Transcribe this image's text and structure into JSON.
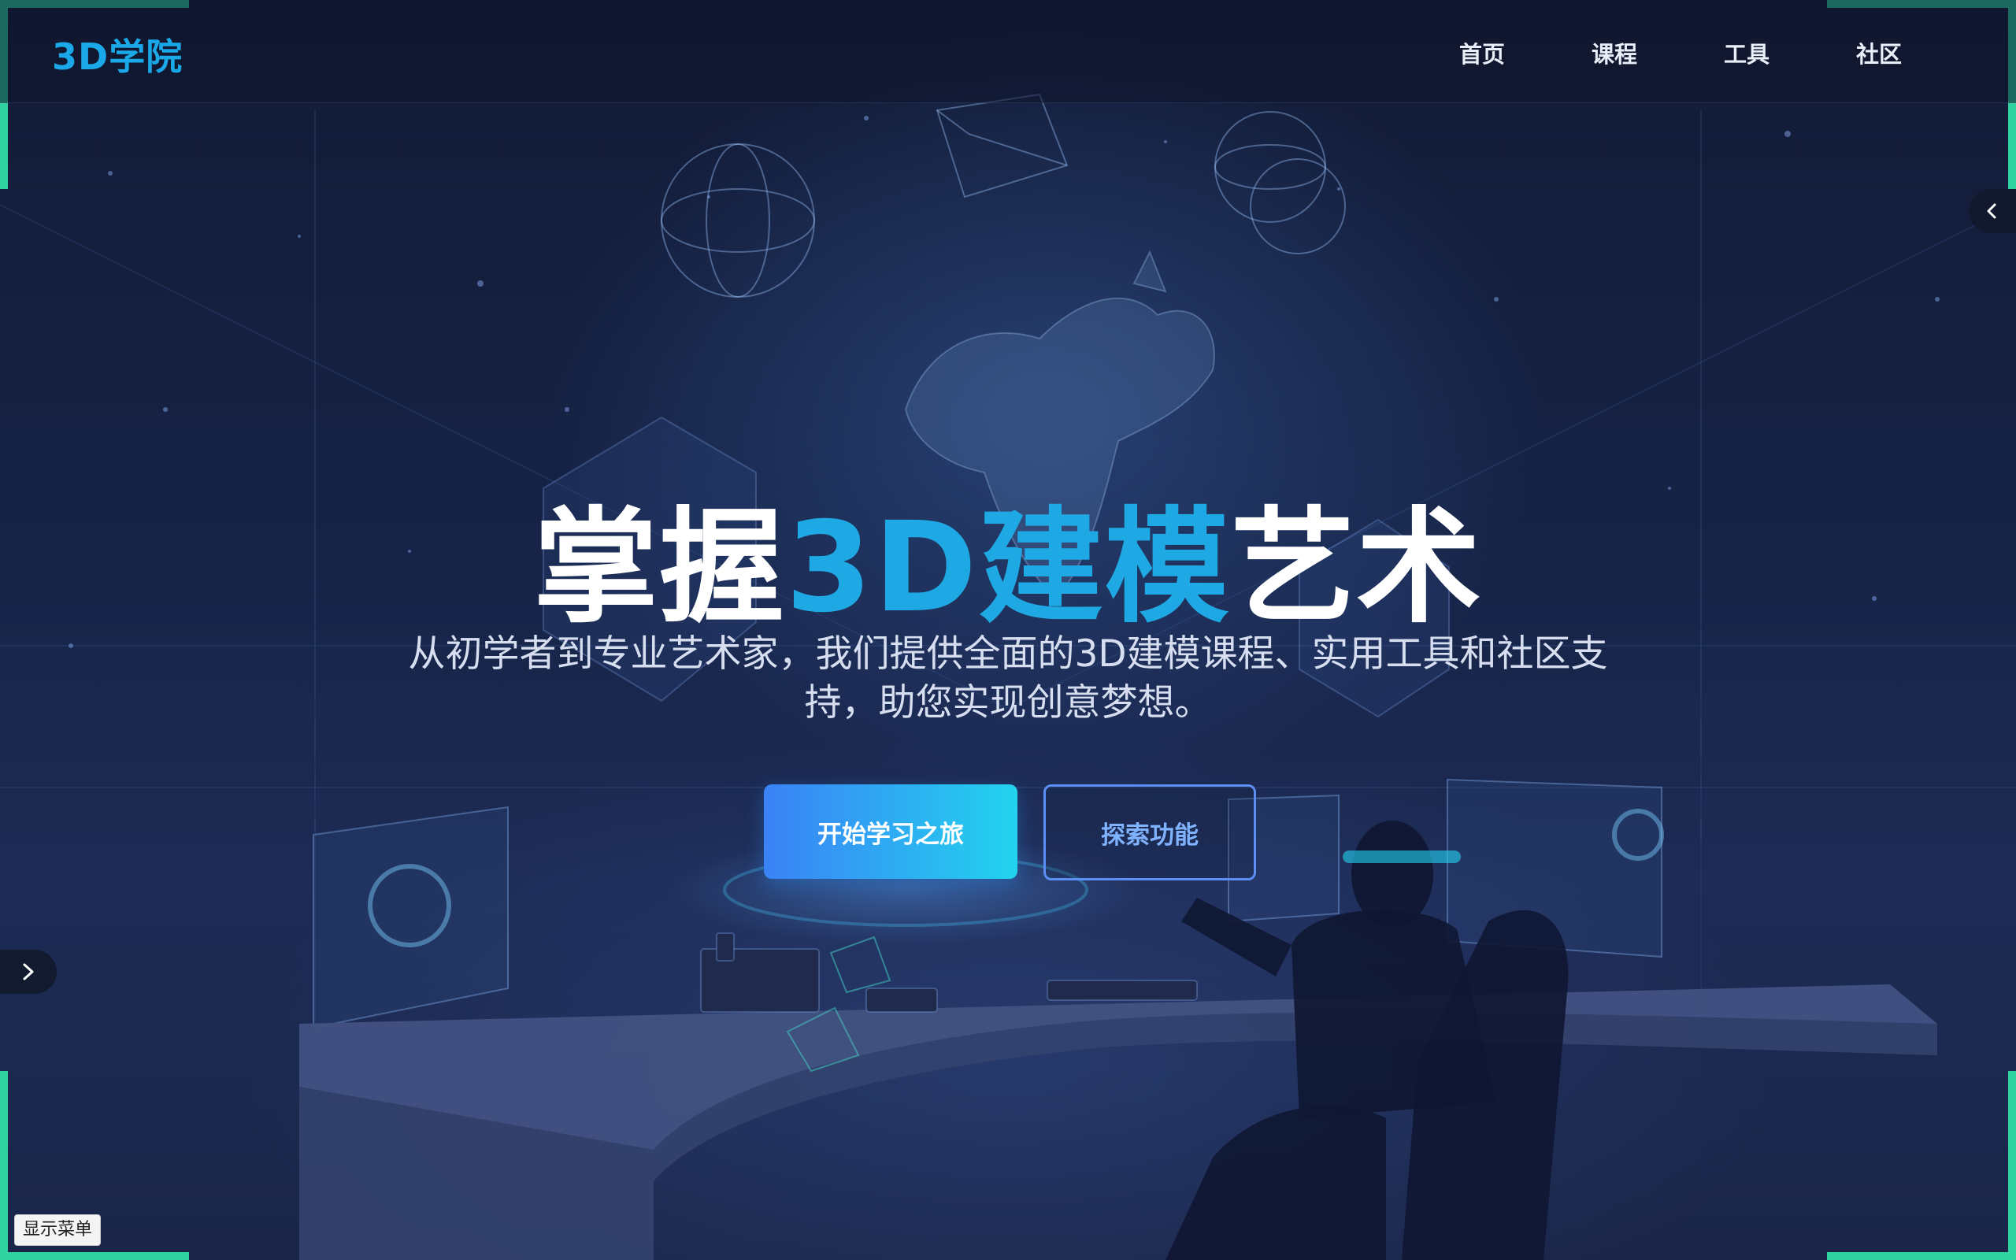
{
  "brand": {
    "logo": "3D学院",
    "accent_color": "#1ba8e8"
  },
  "nav": {
    "items": [
      {
        "label": "首页"
      },
      {
        "label": "课程"
      },
      {
        "label": "工具"
      },
      {
        "label": "社区"
      }
    ]
  },
  "hero": {
    "title_part1": "掌握",
    "title_accent": "3D建模",
    "title_part2": "艺术",
    "subtitle": "从初学者到专业艺术家，我们提供全面的3D建模课程、实用工具和社区支持，助您实现创意梦想。",
    "primary_button": "开始学习之旅",
    "secondary_button": "探索功能"
  },
  "controls": {
    "left_toggle_icon": "chevron-right-icon",
    "right_toggle_icon": "chevron-left-icon",
    "show_menu": "显示菜单"
  },
  "colors": {
    "primary_gradient_start": "#3b82f6",
    "primary_gradient_end": "#22d3ee",
    "outline": "#5b8ff5",
    "corner": "#2ed3a0"
  }
}
